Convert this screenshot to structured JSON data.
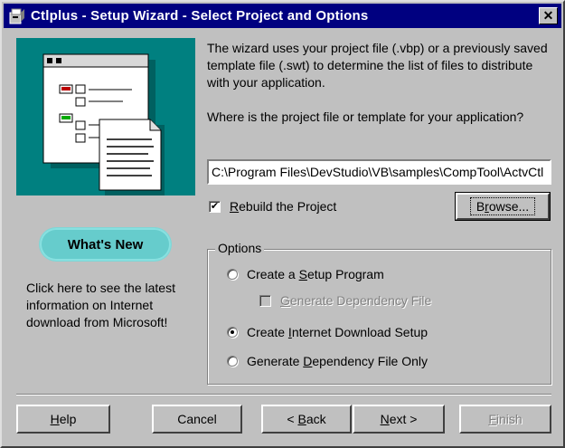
{
  "window": {
    "title": "Ctlplus - Setup Wizard - Select Project and Options",
    "close_glyph": "✕",
    "icon": "setup-wizard-icon"
  },
  "intro_text": "The wizard uses your project file (.vbp) or a previously saved template file (.swt) to determine the list of files to distribute with your application.",
  "question_text": "Where is the project file or template for your application?",
  "project_path": "C:\\Program Files\\DevStudio\\VB\\samples\\CompTool\\ActvCtl",
  "rebuild": {
    "label_pre": "",
    "label_u": "R",
    "label_post": "ebuild the Project",
    "checked": true,
    "check_glyph": "✔"
  },
  "browse_button": {
    "pre": "B",
    "u": "r",
    "post": "owse..."
  },
  "whats_new": {
    "label": "What's New",
    "description": "Click here to see the latest information on Internet download from Microsoft!"
  },
  "options": {
    "label": "Options",
    "create_setup": {
      "pre": "Create a ",
      "u": "S",
      "post": "etup Program",
      "selected": false
    },
    "generate_dep": {
      "pre": "",
      "u": "G",
      "post": "enerate Dependency File",
      "checked": false,
      "enabled": false
    },
    "internet_download": {
      "pre": "Create ",
      "u": "I",
      "post": "nternet Download Setup",
      "selected": true
    },
    "dep_only": {
      "pre": "Generate ",
      "u": "D",
      "post": "ependency File Only",
      "selected": false
    }
  },
  "buttons": {
    "help": {
      "pre": "",
      "u": "H",
      "post": "elp"
    },
    "cancel": {
      "label": "Cancel"
    },
    "back": {
      "pre": "< ",
      "u": "B",
      "post": "ack"
    },
    "next": {
      "pre": "",
      "u": "N",
      "post": "ext >"
    },
    "finish": {
      "pre": "",
      "u": "F",
      "post": "inish",
      "enabled": false
    }
  },
  "colors": {
    "titlebar": "#000080",
    "face": "#c0c0c0",
    "illustration_bg": "#008080",
    "whats_new_bg": "#66cccc"
  }
}
